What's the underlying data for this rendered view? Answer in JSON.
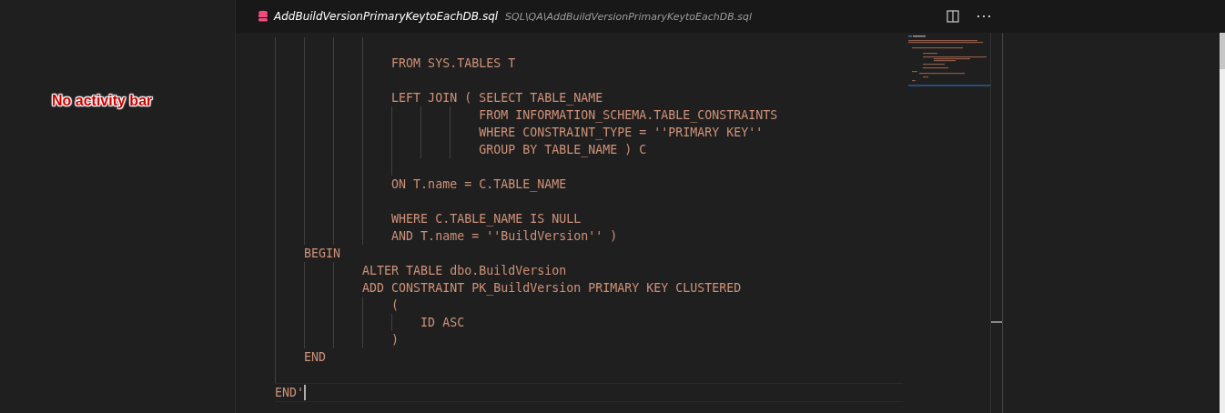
{
  "annotation": "No activity bar",
  "tab": {
    "filename": "AddBuildVersionPrimaryKeytoEachDB.sql",
    "path": "SQL\\QA\\AddBuildVersionPrimaryKeytoEachDB.sql"
  },
  "code_lines": [
    {
      "kind": "blank"
    },
    {
      "kind": "code",
      "text": "                FROM SYS.TABLES T"
    },
    {
      "kind": "blank"
    },
    {
      "kind": "code",
      "text": "                LEFT JOIN ( SELECT TABLE_NAME"
    },
    {
      "kind": "code",
      "text": "                            FROM INFORMATION_SCHEMA.TABLE_CONSTRAINTS"
    },
    {
      "kind": "code",
      "text": "                            WHERE CONSTRAINT_TYPE = ''PRIMARY KEY''"
    },
    {
      "kind": "code",
      "text": "                            GROUP BY TABLE_NAME ) C"
    },
    {
      "kind": "blank"
    },
    {
      "kind": "code",
      "text": "                ON T.name = C.TABLE_NAME"
    },
    {
      "kind": "blank"
    },
    {
      "kind": "code",
      "text": "                WHERE C.TABLE_NAME IS NULL"
    },
    {
      "kind": "code",
      "text": "                AND T.name = ''BuildVersion'' )"
    },
    {
      "kind": "code",
      "text": "    BEGIN"
    },
    {
      "kind": "code",
      "text": "            ALTER TABLE dbo.BuildVersion"
    },
    {
      "kind": "code",
      "text": "            ADD CONSTRAINT PK_BuildVersion PRIMARY KEY CLUSTERED"
    },
    {
      "kind": "code",
      "text": "                ("
    },
    {
      "kind": "code",
      "text": "                    ID ASC"
    },
    {
      "kind": "code",
      "text": "                )"
    },
    {
      "kind": "code",
      "text": "    END"
    },
    {
      "kind": "blank"
    },
    {
      "kind": "code",
      "text": "END'",
      "current": true
    }
  ]
}
